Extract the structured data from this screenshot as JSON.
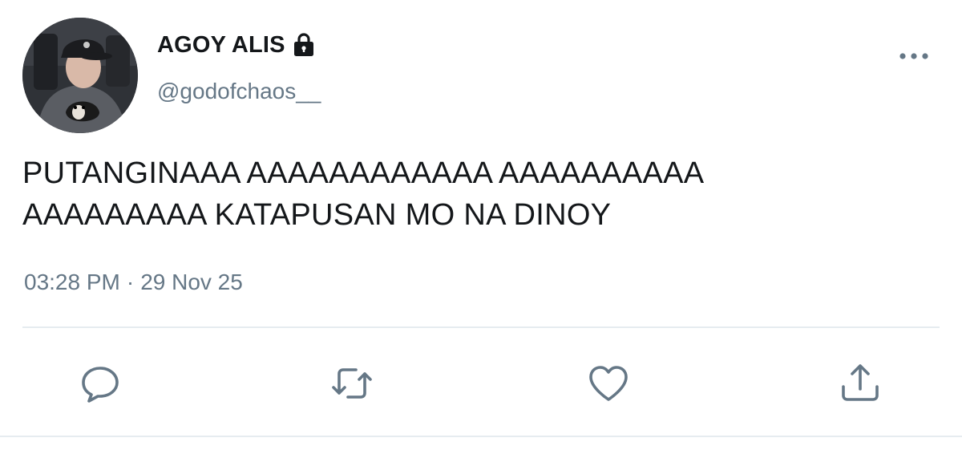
{
  "user": {
    "display_name": "AGOY ALIS",
    "handle": "@godofchaos__",
    "protected_icon": "lock-icon",
    "avatar_icon": "avatar-photo"
  },
  "tweet": {
    "lines": [
      "PUTANGINAAA AAAAAAAAAAAA AAAAAAAAAA",
      "AAAAAAAAA KATAPUSAN MO NA DINOY"
    ],
    "time": "03:28 PM",
    "separator": "·",
    "date": "29 Nov 25"
  },
  "actions": {
    "reply_icon": "comment-icon",
    "retweet_icon": "retweet-icon",
    "like_icon": "heart-icon",
    "share_icon": "share-icon"
  },
  "more_icon": "more-options-icon",
  "colors": {
    "text_primary": "#14171a",
    "text_secondary": "#657786",
    "icon_gray": "#657786",
    "divider": "#e6ecf0",
    "background": "#ffffff"
  }
}
